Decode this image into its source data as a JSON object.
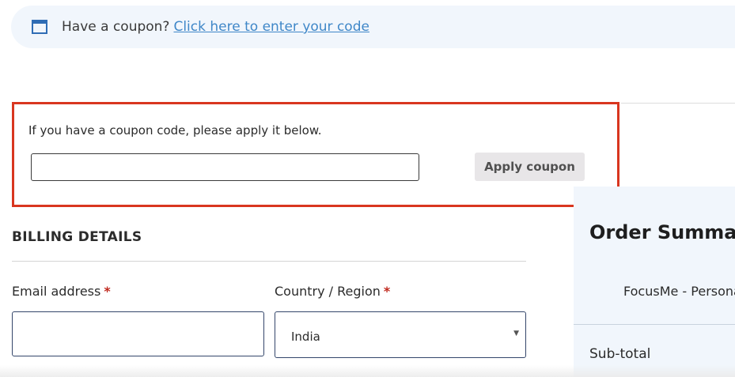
{
  "coupon_notice": {
    "text": "Have a coupon?",
    "link": "Click here to enter your code",
    "icon": "window-icon"
  },
  "coupon_form": {
    "help_text": "If you have a coupon code, please apply it below.",
    "input_value": "",
    "apply_label": "Apply coupon"
  },
  "billing": {
    "title": "BILLING DETAILS",
    "email_label": "Email address",
    "country_label": "Country / Region",
    "required_mark": "*",
    "country_value": "India"
  },
  "order_summary": {
    "title": "Order Summary",
    "item": "FocusMe - Personal",
    "subtotal_label": "Sub-total"
  },
  "colors": {
    "accent_link": "#3f87c8",
    "highlight_border": "#d9361f",
    "panel_bg": "#f1f6fc",
    "required": "#c0281d"
  }
}
